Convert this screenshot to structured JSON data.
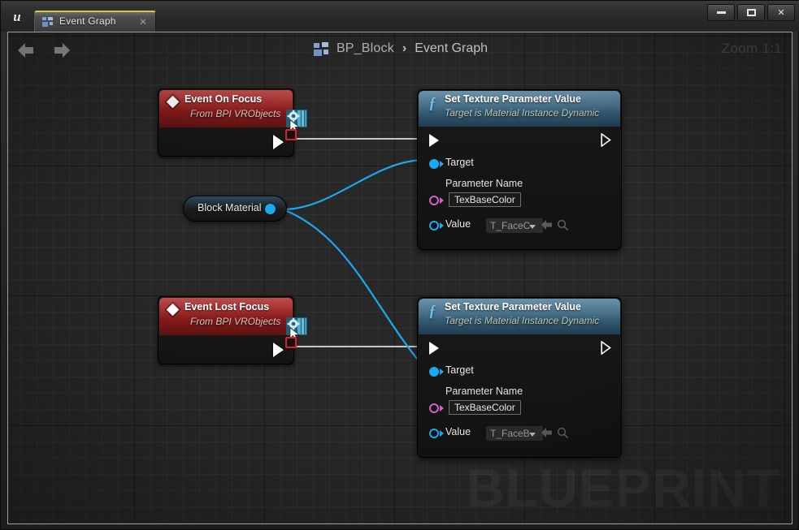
{
  "window": {
    "titlebar": {
      "logo": "ue-logo",
      "minimize_label": "minimize",
      "maximize_label": "maximize",
      "close_label": "✕"
    },
    "tabs": [
      {
        "label": "Event Graph",
        "icon": "blueprint-icon",
        "close": "✕",
        "active": true
      }
    ]
  },
  "toolbar": {
    "back_label": "back-arrow",
    "forward_label": "forward-arrow",
    "zoom_label": "Zoom 1:1"
  },
  "breadcrumb": {
    "icon": "blueprint-icon",
    "root": "BP_Block",
    "separator": "›",
    "current": "Event Graph"
  },
  "canvas": {
    "watermark": "BLUEPRINT",
    "background_color": "#282828",
    "grid_minor_color": "#303030",
    "grid_major_color": "#151515"
  },
  "colors": {
    "event_header": "#8e1c1c",
    "function_header": "#3d6780",
    "exec_wire": "#c8c8c8",
    "data_wire": "#19aaf0",
    "object_pin": "#19aaf0",
    "name_pin": "#d65fd0",
    "texture_pin": "#19aaf0",
    "tab_accent": "#d8c44a"
  },
  "nodes": {
    "event_on_focus": {
      "title": "Event On Focus",
      "subtitle": "From BPI VRObjects",
      "badge": "interface-event-badge",
      "overlay_icon": "blueprint-interface-icon",
      "exec_out_label": "exec-out"
    },
    "event_lost_focus": {
      "title": "Event Lost Focus",
      "subtitle": "From BPI VRObjects",
      "badge": "interface-event-badge",
      "overlay_icon": "blueprint-interface-icon",
      "exec_out_label": "exec-out"
    },
    "block_material": {
      "label": "Block Material",
      "pin": "output-object-pin"
    },
    "set_texture_1": {
      "title": "Set Texture Parameter Value",
      "subtitle": "Target is Material Instance Dynamic",
      "pins": {
        "target": "Target",
        "parameter_name_label": "Parameter Name",
        "parameter_name_value": "TexBaseColor",
        "value_label": "Value",
        "value_selected": "T_FaceC"
      }
    },
    "set_texture_2": {
      "title": "Set Texture Parameter Value",
      "subtitle": "Target is Material Instance Dynamic",
      "pins": {
        "target": "Target",
        "parameter_name_label": "Parameter Name",
        "parameter_name_value": "TexBaseColor",
        "value_label": "Value",
        "value_selected": "T_FaceB"
      }
    }
  }
}
